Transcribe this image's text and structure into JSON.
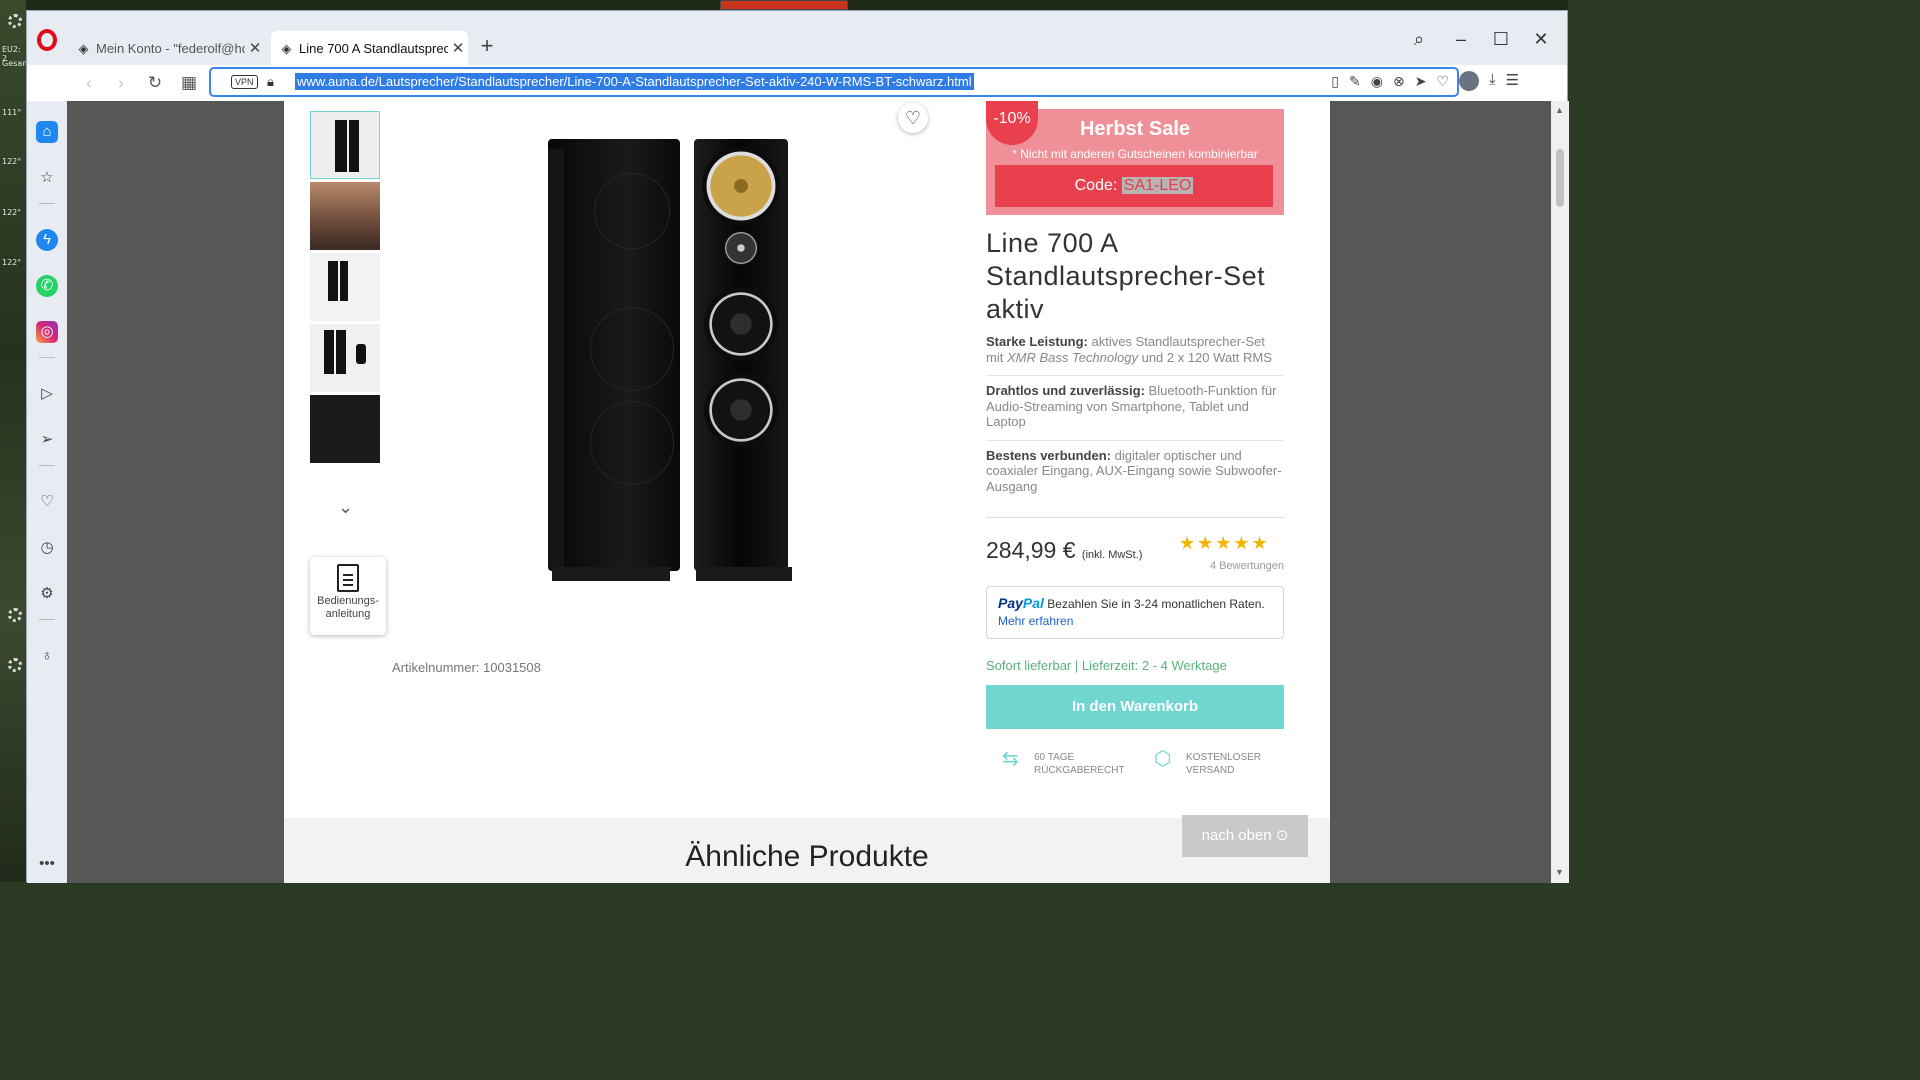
{
  "browser": {
    "tabs": [
      {
        "label": "Mein Konto - \"federolf@ho",
        "active": false
      },
      {
        "label": "Line 700 A Standlautsprech",
        "active": true
      }
    ],
    "url": "www.auna.de/Lautsprecher/Standlautsprecher/Line-700-A-Standlautsprecher-Set-aktiv-240-W-RMS-BT-schwarz.html",
    "vpn_label": "VPN"
  },
  "desktop": {
    "labels": [
      "EU2: 2",
      "Gesam",
      "111°",
      "122°",
      "122°",
      "122°"
    ]
  },
  "product": {
    "promo": {
      "percent": "-10%",
      "title": "Herbst Sale",
      "subtitle": "* Nicht mit anderen Gutscheinen kombinierbar",
      "code_label": "Code:",
      "code": "SA1-LEO"
    },
    "name": "Line 700 A Standlautsprecher-Set aktiv",
    "bullets": [
      {
        "bold": "Starke Leistung:",
        "text_before": " aktives Standlautsprecher-Set mit ",
        "italic": "XMR Bass Technology",
        "text_after": " und 2 x 120 Watt RMS"
      },
      {
        "bold": "Drahtlos und zuverlässig:",
        "text_before": " Bluetooth-Funktion für Audio-Streaming von Smartphone, Tablet und Laptop",
        "italic": "",
        "text_after": ""
      },
      {
        "bold": "Bestens verbunden:",
        "text_before": " digitaler optischer und coaxialer Eingang, AUX-Eingang sowie Subwoofer-Ausgang",
        "italic": "",
        "text_after": ""
      }
    ],
    "price": "284,99 €",
    "price_note": "(inkl. MwSt.)",
    "rating": 5,
    "reviews": "4 Bewertungen",
    "paypal": {
      "brand_a": "Pay",
      "brand_b": "Pal",
      "text": " Bezahlen Sie in 3-24 monatlichen Raten. ",
      "link": "Mehr erfahren"
    },
    "delivery": "Sofort lieferbar | Lieferzeit: 2 - 4 Werktage",
    "cart_button": "In den Warenkorb",
    "usp": [
      {
        "line1": "60 TAGE",
        "line2": "RÜCKGABERECHT"
      },
      {
        "line1": "KOSTENLOSER",
        "line2": "VERSAND"
      }
    ],
    "manual_label_1": "Bedienungs-",
    "manual_label_2": "anleitung",
    "article_number": "Artikelnummer: 10031508"
  },
  "similar_heading": "Ähnliche Produkte",
  "to_top": "nach oben",
  "colors": {
    "accent": "#6fd6d0",
    "sale": "#e8404c",
    "opera": "#e0091e"
  }
}
